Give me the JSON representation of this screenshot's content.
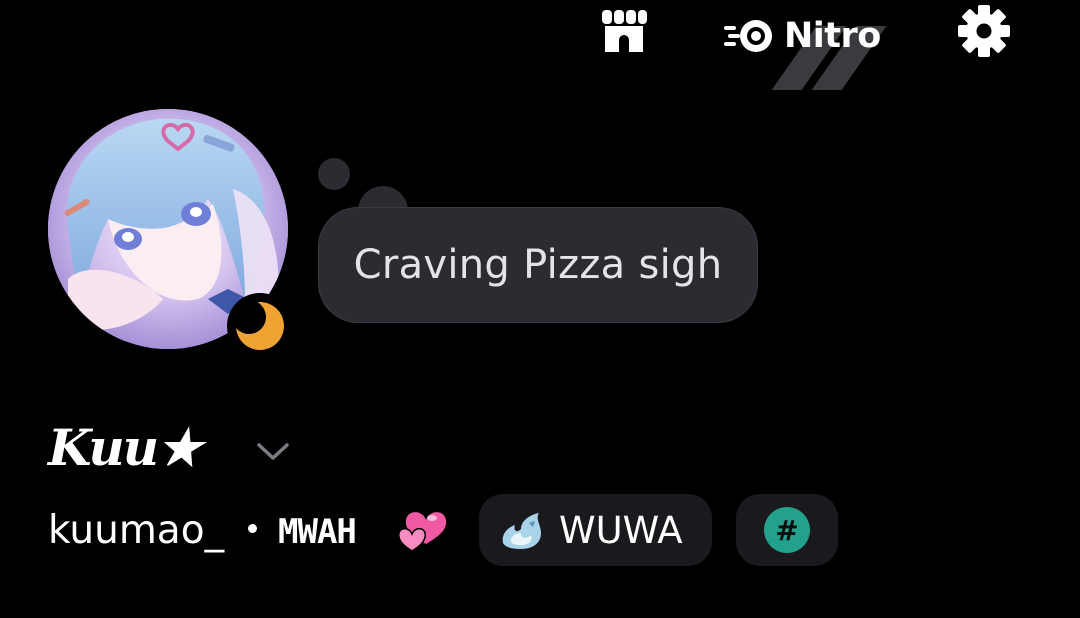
{
  "topbar": {
    "shop_icon": "shop-icon",
    "nitro_icon": "nitro-icon",
    "nitro_label": "Nitro",
    "settings_icon": "gear-icon"
  },
  "profile": {
    "avatar_icon": "avatar",
    "status_icon": "moon-idle-icon",
    "status_color": "#f0a232",
    "custom_status": "Craving Pizza sigh",
    "display_name": "Kuu★",
    "username": "kuumao_",
    "pronouns": "MWAH",
    "pronouns_emoji": "two-hearts-icon"
  },
  "tags": {
    "server_tag_icon": "crystal-flame-icon",
    "server_tag_label": "WUWA",
    "hash_label": "#",
    "hash_color": "#23a18c"
  },
  "colors": {
    "background": "#000000",
    "bubble": "#2b2c31",
    "chip": "#1a1a1e"
  }
}
